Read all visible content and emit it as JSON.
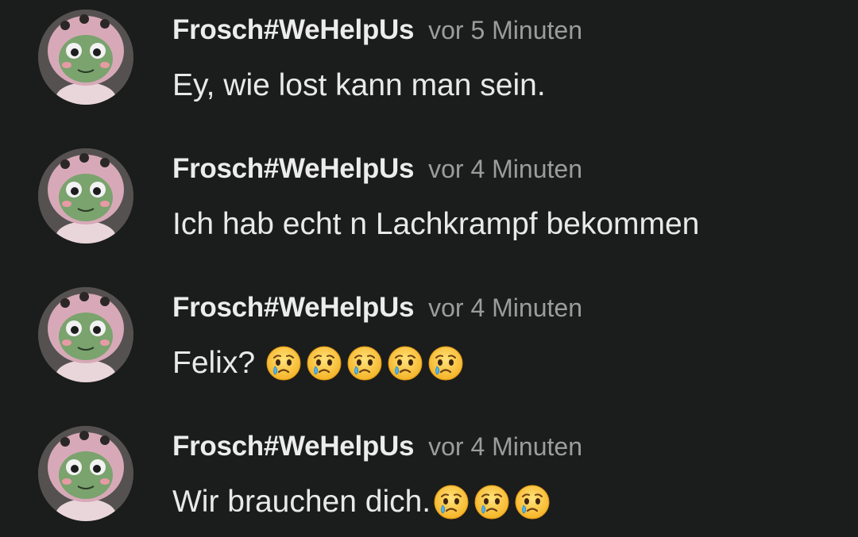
{
  "messages": [
    {
      "author": "Frosch#WeHelpUs",
      "time": "vor 5 Minuten",
      "text": "Ey, wie lost kann man sein.",
      "emojis": []
    },
    {
      "author": "Frosch#WeHelpUs",
      "time": "vor 4 Minuten",
      "text": "Ich hab echt n Lachkrampf bekommen",
      "emojis": []
    },
    {
      "author": "Frosch#WeHelpUs",
      "time": "vor 4 Minuten",
      "text": "Felix?",
      "emojis": [
        "crying-face-emoji",
        "crying-face-emoji",
        "crying-face-emoji",
        "crying-face-emoji",
        "crying-face-emoji"
      ]
    },
    {
      "author": "Frosch#WeHelpUs",
      "time": "vor 4 Minuten",
      "text": "Wir brauchen dich.",
      "emojis": [
        "crying-face-emoji",
        "crying-face-emoji",
        "crying-face-emoji"
      ]
    }
  ],
  "colors": {
    "background": "#1b1c1c",
    "author": "#ececec",
    "timestamp": "#9c9c9c",
    "message": "#e9e9e9"
  }
}
